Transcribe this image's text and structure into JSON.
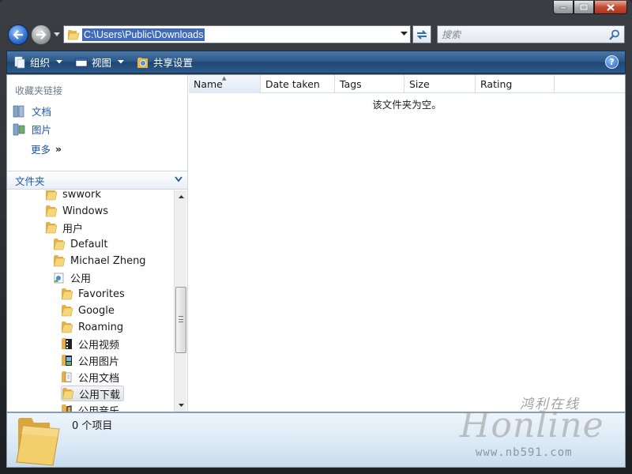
{
  "window": {
    "caption_buttons": [
      "minimize",
      "maximize",
      "close"
    ]
  },
  "address_bar": {
    "path": "C:\\Users\\Public\\Downloads"
  },
  "search": {
    "placeholder": "搜索"
  },
  "toolbar": {
    "organize_label": "组织",
    "views_label": "视图",
    "share_label": "共享设置",
    "help_label": "?"
  },
  "sidebar": {
    "favorites_title": "收藏夹链接",
    "favorites": [
      {
        "label": "文档",
        "icon": "documents-icon"
      },
      {
        "label": "图片",
        "icon": "pictures-icon"
      }
    ],
    "more_label": "更多",
    "more_chevron": "»",
    "folders_header": "文件夹",
    "tree": [
      {
        "label": "swwork",
        "icon": "folder-icon"
      },
      {
        "label": "Windows",
        "icon": "folder-icon"
      },
      {
        "label": "用户",
        "icon": "folder-icon"
      },
      {
        "label": "Default",
        "icon": "folder-icon"
      },
      {
        "label": "Michael Zheng",
        "icon": "folder-icon"
      },
      {
        "label": "公用",
        "icon": "public-folder-icon"
      },
      {
        "label": "Favorites",
        "icon": "folder-icon"
      },
      {
        "label": "Google",
        "icon": "folder-icon"
      },
      {
        "label": "Roaming",
        "icon": "folder-icon"
      },
      {
        "label": "公用视频",
        "icon": "videos-folder-icon"
      },
      {
        "label": "公用图片",
        "icon": "pictures-folder-icon"
      },
      {
        "label": "公用文档",
        "icon": "documents-folder-icon"
      },
      {
        "label": "公用下载",
        "icon": "folder-icon",
        "selected": true
      },
      {
        "label": "公用音乐",
        "icon": "music-folder-icon"
      }
    ]
  },
  "file_list": {
    "columns": [
      "Name",
      "Date taken",
      "Tags",
      "Size",
      "Rating"
    ],
    "empty_message": "该文件夹为空。"
  },
  "details": {
    "item_count": "0 个项目"
  },
  "watermark": {
    "cn": "鸿利在线",
    "main": "Honline",
    "url": "www.nb591.com"
  },
  "colors": {
    "toolbar": "#2a5585",
    "link": "#1d57a6",
    "selection": "#3f6bb7"
  }
}
